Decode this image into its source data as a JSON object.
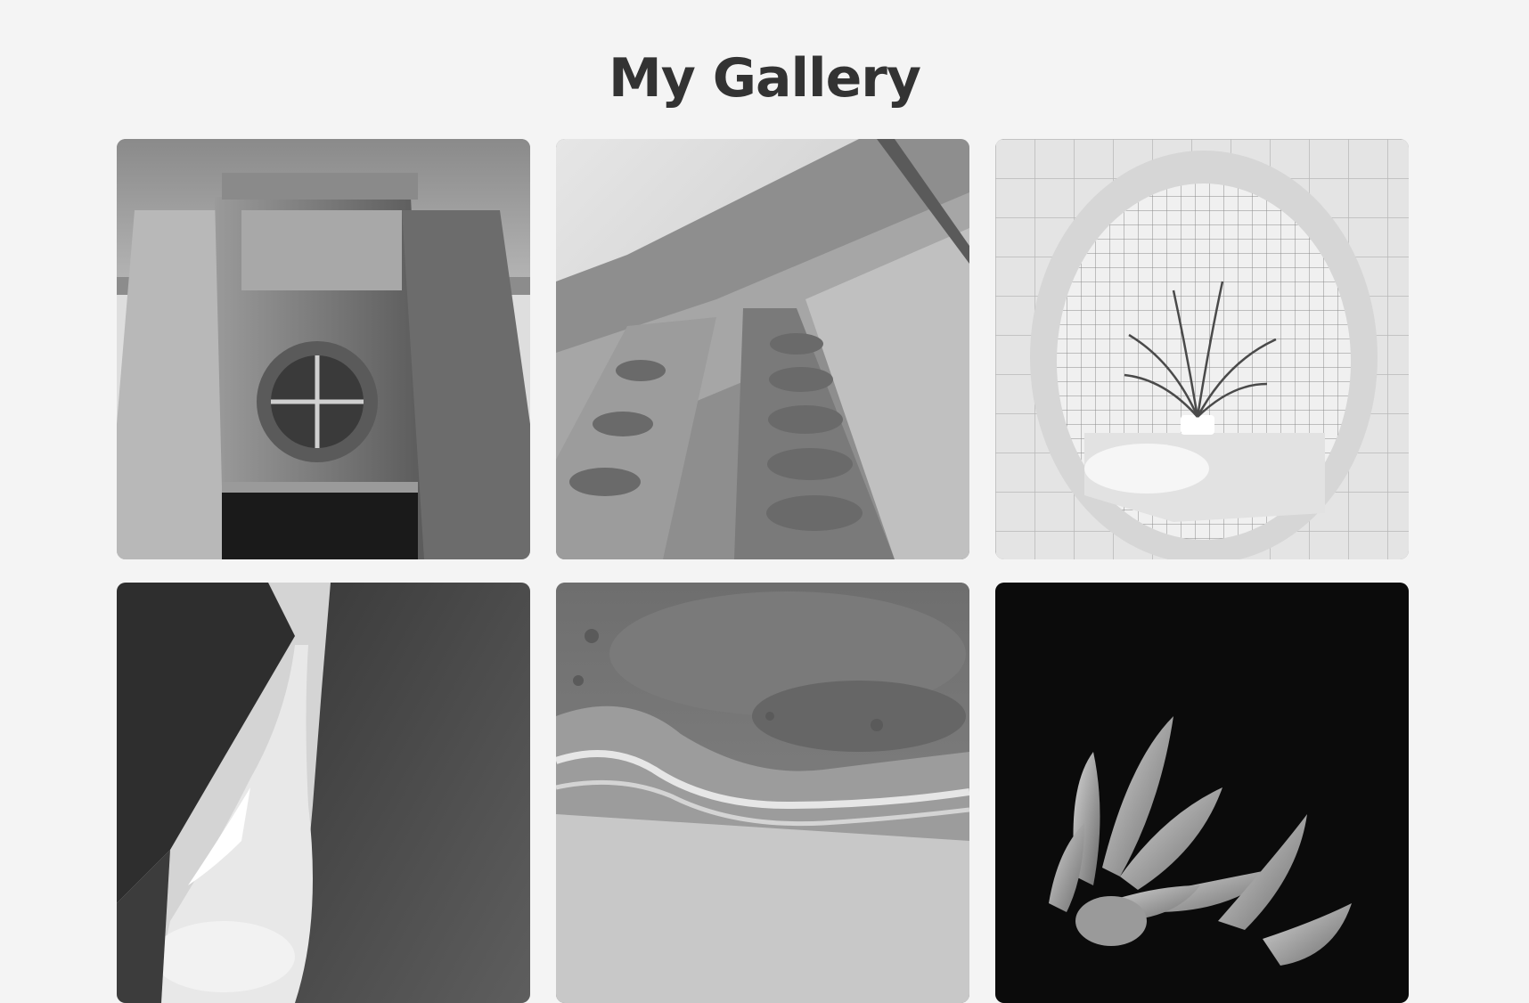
{
  "page": {
    "title": "My Gallery"
  },
  "gallery": {
    "items": [
      {
        "subject": "building-facade",
        "alt": ""
      },
      {
        "subject": "cathedral-columns",
        "alt": ""
      },
      {
        "subject": "tiled-room-plant",
        "alt": ""
      },
      {
        "subject": "waterfall-cliff",
        "alt": ""
      },
      {
        "subject": "aerial-shoreline",
        "alt": ""
      },
      {
        "subject": "flower-petals",
        "alt": ""
      }
    ]
  },
  "colors": {
    "background": "#f4f4f4",
    "title": "#333333"
  }
}
